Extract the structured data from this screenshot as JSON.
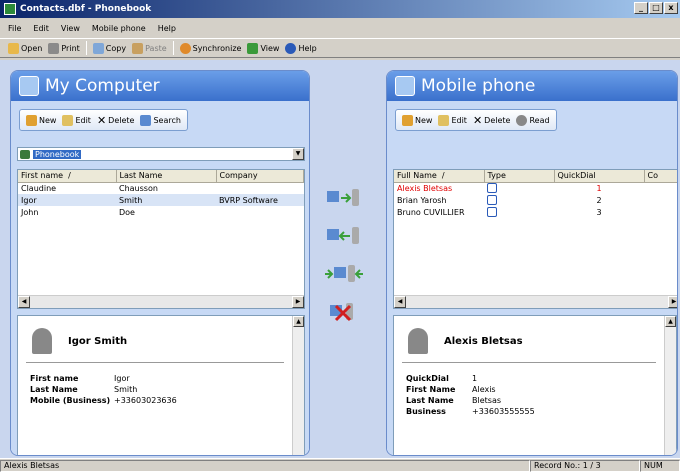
{
  "window": {
    "title": "Contacts.dbf - Phonebook",
    "controls": [
      "_",
      "□",
      "x"
    ]
  },
  "menu": [
    "File",
    "Edit",
    "View",
    "Mobile phone",
    "Help"
  ],
  "toolbar": [
    {
      "label": "Open",
      "icon": "folder-icon",
      "color": "#e8b84a"
    },
    {
      "label": "Print",
      "icon": "printer-icon",
      "color": "#8a8a8a"
    },
    {
      "label": "Copy",
      "icon": "copy-icon",
      "color": "#7fa7d8"
    },
    {
      "label": "Paste",
      "icon": "paste-icon",
      "color": "#c8a060"
    },
    {
      "label": "Synchronize",
      "icon": "sync-icon",
      "color": "#e08a2a"
    },
    {
      "label": "View",
      "icon": "view-icon",
      "color": "#3a9a3a"
    },
    {
      "label": "Help",
      "icon": "help-icon",
      "color": "#2a5ab8"
    }
  ],
  "left": {
    "title": "My Computer",
    "actions": [
      {
        "label": "New",
        "icon": "new-icon",
        "color": "#e0a030"
      },
      {
        "label": "Edit",
        "icon": "edit-icon",
        "color": "#e0c060"
      },
      {
        "label": "Delete",
        "icon": "delete-icon",
        "color": "#333333"
      },
      {
        "label": "Search",
        "icon": "search-icon",
        "color": "#5a8ad0"
      }
    ],
    "phonebook": "Phonebook",
    "columns": [
      "First name",
      "Last Name",
      "Company"
    ],
    "rows": [
      [
        "Claudine",
        "Chausson",
        ""
      ],
      [
        "Igor",
        "Smith",
        "BVRP Software"
      ],
      [
        "John",
        "Doe",
        ""
      ]
    ],
    "detail": {
      "name": "Igor Smith",
      "fields": [
        {
          "k": "First name",
          "v": "Igor"
        },
        {
          "k": "Last Name",
          "v": "Smith"
        },
        {
          "k": "Mobile (Business)",
          "v": "+33603023636"
        }
      ]
    }
  },
  "right": {
    "title": "Mobile phone",
    "actions": [
      {
        "label": "New",
        "icon": "new-icon",
        "color": "#e0a030"
      },
      {
        "label": "Edit",
        "icon": "edit-icon",
        "color": "#e0c060"
      },
      {
        "label": "Delete",
        "icon": "delete-icon",
        "color": "#333333"
      },
      {
        "label": "Read",
        "icon": "read-icon",
        "color": "#888888"
      }
    ],
    "columns": [
      "Full Name",
      "Type",
      "QuickDial",
      "Co"
    ],
    "rows": [
      [
        "Alexis Bletsas",
        "1"
      ],
      [
        "Brian Yarosh",
        "2"
      ],
      [
        "Bruno CUVILLIER",
        "3"
      ]
    ],
    "detail": {
      "name": "Alexis Bletsas",
      "fields": [
        {
          "k": "QuickDial",
          "v": "1"
        },
        {
          "k": "First Name",
          "v": "Alexis"
        },
        {
          "k": "Last Name",
          "v": "Bletsas"
        },
        {
          "k": "Business",
          "v": "+33603555555"
        }
      ]
    }
  },
  "status": {
    "left": "Alexis Bletsas",
    "record": "Record No.: 1 / 3",
    "num": "NUM"
  }
}
